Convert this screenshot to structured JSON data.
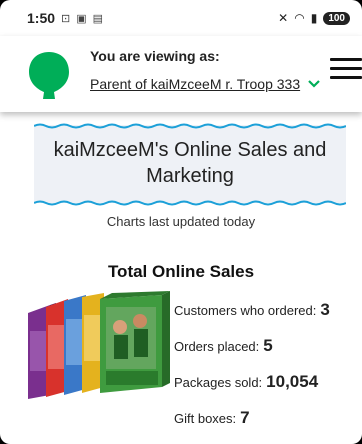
{
  "status_bar": {
    "time": "1:50",
    "battery": "100",
    "left_icons": [
      "message-icon",
      "photo-icon",
      "chat-icon"
    ],
    "right_icons": [
      "mute-icon",
      "wifi-icon",
      "signal-icon",
      "battery-icon"
    ]
  },
  "header": {
    "viewing_label": "You are viewing as:",
    "viewing_value": "Parent of kaiMzceeM r. Troop 333",
    "brand_color": "#00ae58"
  },
  "main": {
    "title": "kaiMzceeM's Online Sales and Marketing",
    "updated": "Charts last updated today",
    "section_title": "Total Online Sales",
    "stats": [
      {
        "label": "Customers who ordered:",
        "value": "3"
      },
      {
        "label": "Orders placed:",
        "value": "5"
      },
      {
        "label": "Packages sold:",
        "value": "10,054"
      },
      {
        "label": "Gift boxes:",
        "value": "7"
      }
    ]
  }
}
